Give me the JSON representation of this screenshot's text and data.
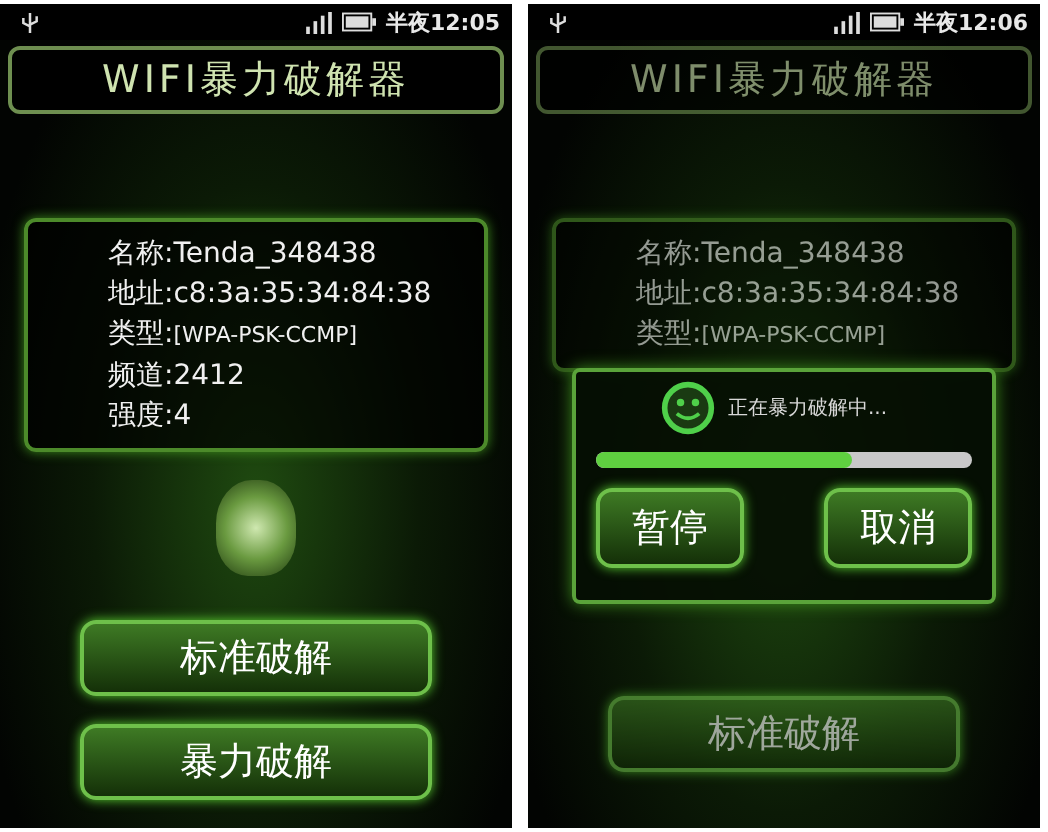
{
  "screens": [
    {
      "status_bar": {
        "time": "半夜12:05"
      },
      "title": "WIFI暴力破解器",
      "network": {
        "fields": [
          {
            "label": "名称:",
            "value": "Tenda_348438",
            "kind": "normal"
          },
          {
            "label": "地址:",
            "value": "c8:3a:35:34:84:38",
            "kind": "normal"
          },
          {
            "label": "类型:",
            "value": "[WPA-PSK-CCMP]",
            "kind": "small"
          },
          {
            "label": "频道:",
            "value": "2412",
            "kind": "normal"
          },
          {
            "label": "强度:",
            "value": "4",
            "kind": "normal"
          }
        ]
      },
      "buttons": [
        {
          "label": "标准破解"
        },
        {
          "label": "暴力破解"
        }
      ]
    },
    {
      "status_bar": {
        "time": "半夜12:06"
      },
      "title": "WIFI暴力破解器",
      "network": {
        "fields": [
          {
            "label": "名称:",
            "value": "Tenda_348438",
            "kind": "normal"
          },
          {
            "label": "地址:",
            "value": "c8:3a:35:34:84:38",
            "kind": "normal"
          },
          {
            "label": "类型:",
            "value": "[WPA-PSK-CCMP]",
            "kind": "small"
          }
        ]
      },
      "dialog": {
        "message": "正在暴力破解中...",
        "level": 0.68,
        "buttons": [
          {
            "label": "暂停"
          },
          {
            "label": "取消"
          }
        ]
      },
      "buttons": [
        {
          "label": "标准破解"
        }
      ]
    }
  ]
}
